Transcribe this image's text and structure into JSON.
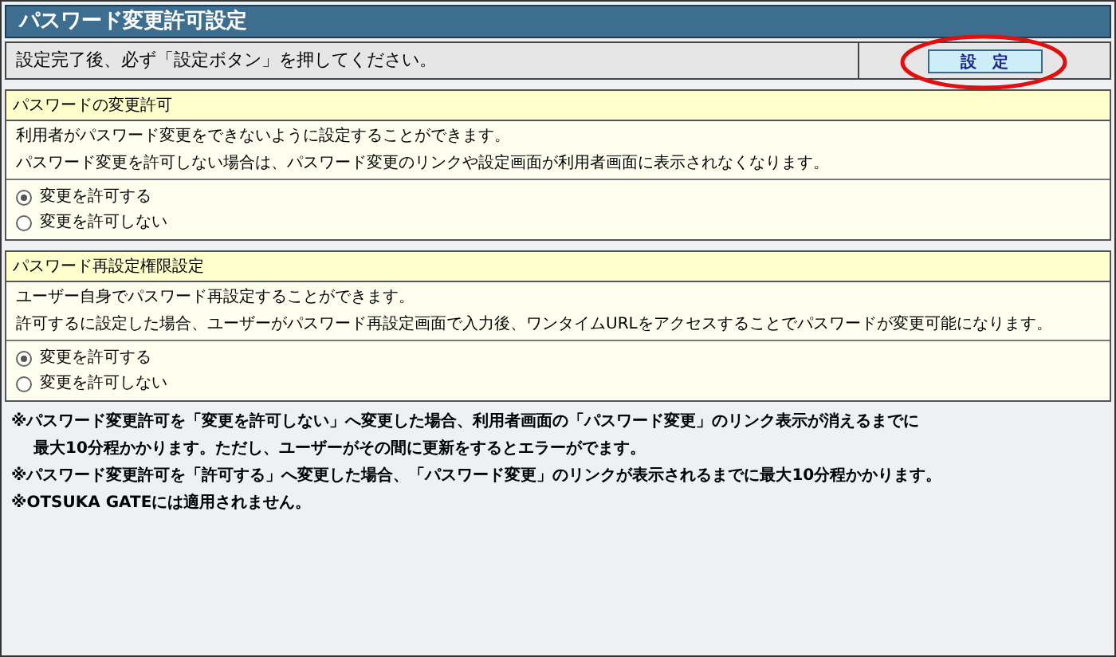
{
  "title": "パスワード変更許可設定",
  "instruction": {
    "text": "設定完了後、必ず「設定ボタン」を押してください。",
    "button": "設　定",
    "highlighted": true
  },
  "sections": [
    {
      "heading": "パスワードの変更許可",
      "description": [
        "利用者がパスワード変更をできないように設定することができます。",
        "パスワード変更を許可しない場合は、パスワード変更のリンクや設定画面が利用者画面に表示されなくなります。"
      ],
      "options": [
        {
          "label": "変更を許可する",
          "selected": true
        },
        {
          "label": "変更を許可しない",
          "selected": false
        }
      ]
    },
    {
      "heading": "パスワード再設定権限設定",
      "description": [
        "ユーザー自身でパスワード再設定することができます。",
        "許可するに設定した場合、ユーザーがパスワード再設定画面で入力後、ワンタイムURLをアクセスすることでパスワードが変更可能になります。"
      ],
      "options": [
        {
          "label": "変更を許可する",
          "selected": true
        },
        {
          "label": "変更を許可しない",
          "selected": false
        }
      ]
    }
  ],
  "notes": [
    {
      "lines": [
        "※パスワード変更許可を「変更を許可しない」へ変更した場合、利用者画面の「パスワード変更」のリンク表示が消えるまでに",
        "最大10分程かかります。ただし、ユーザーがその間に更新をするとエラーがでます。"
      ]
    },
    {
      "lines": [
        "※パスワード変更許可を「許可する」へ変更した場合、「パスワード変更」のリンクが表示されるまでに最大10分程かかります。"
      ]
    },
    {
      "lines": [
        "※OTSUKA GATEには適用されません。"
      ]
    }
  ]
}
